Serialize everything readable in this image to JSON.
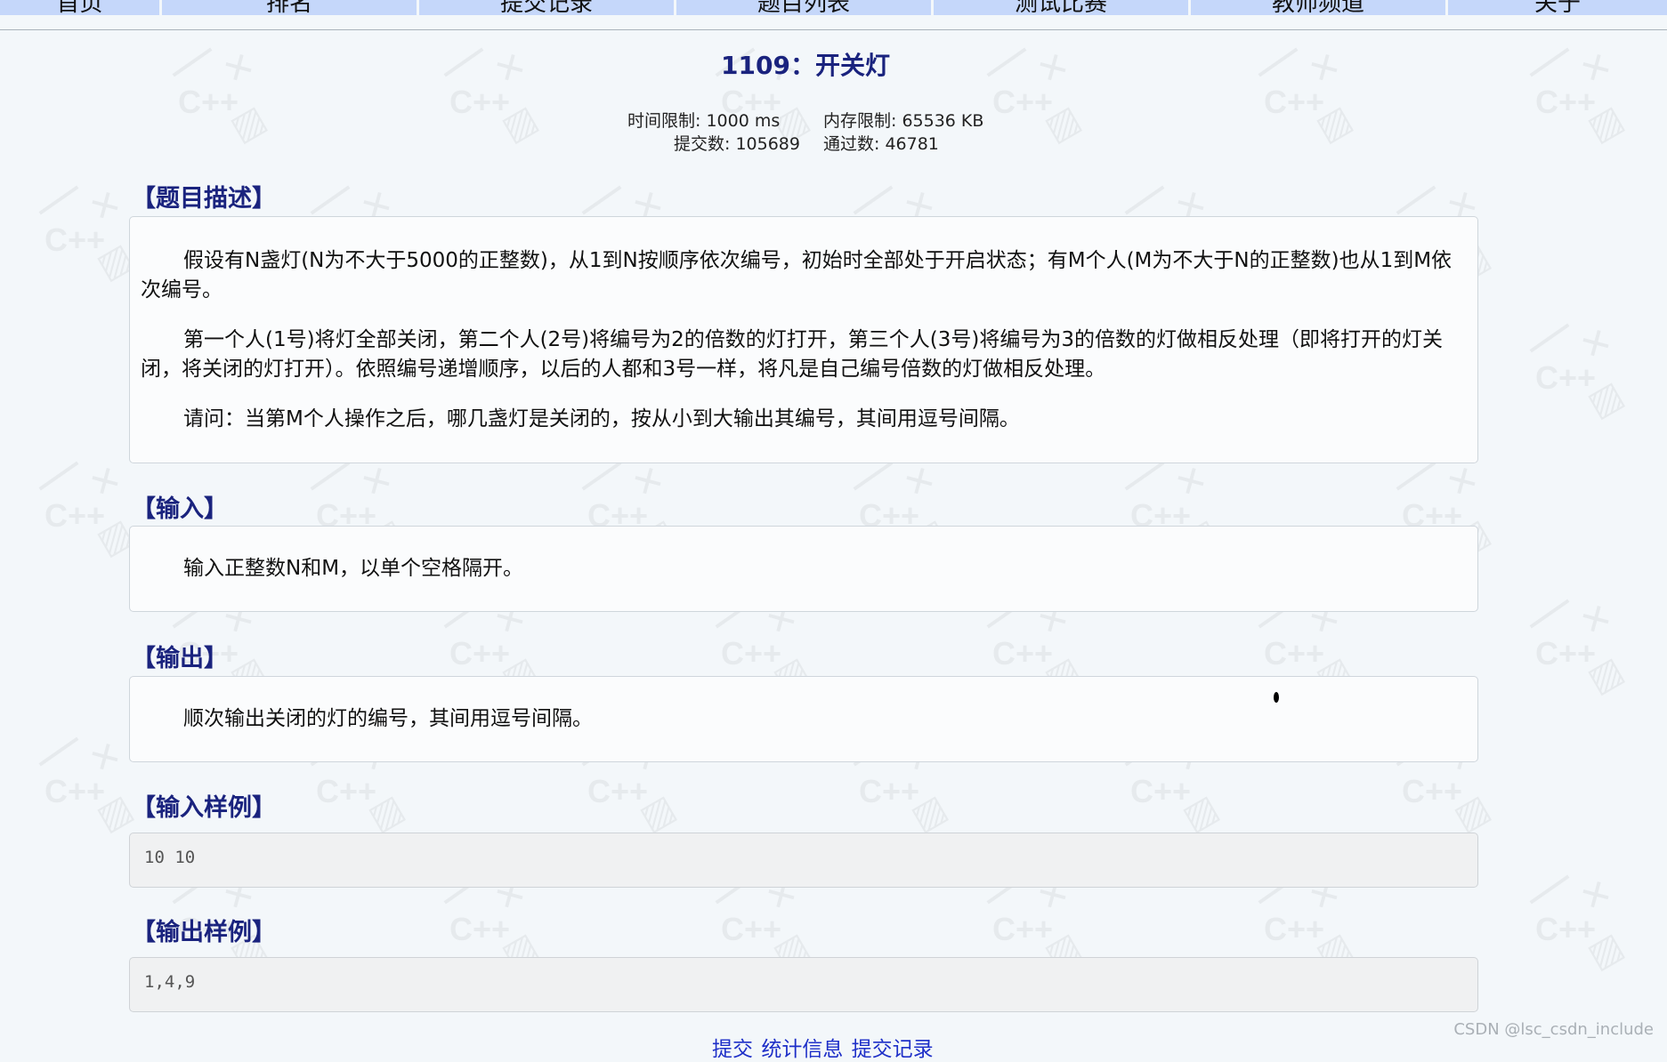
{
  "nav": {
    "items": [
      {
        "label": "首页"
      },
      {
        "label": "排名"
      },
      {
        "label": "提交记录"
      },
      {
        "label": "题目列表"
      },
      {
        "label": "测试比赛"
      },
      {
        "label": "教师频道"
      },
      {
        "label": "关于"
      }
    ]
  },
  "problem": {
    "title": "1109：开关灯",
    "time_limit": "时间限制: 1000 ms",
    "memory_limit": "内存限制: 65536 KB",
    "submissions": "提交数: 105689",
    "accepted": "通过数: 46781"
  },
  "sections": {
    "description": {
      "heading": "【题目描述】",
      "paragraphs": [
        "假设有N盏灯(N为不大于5000的正整数)，从1到N按顺序依次编号，初始时全部处于开启状态；有M个人(M为不大于N的正整数)也从1到M依次编号。",
        "第一个人(1号)将灯全部关闭，第二个人(2号)将编号为2的倍数的灯打开，第三个人(3号)将编号为3的倍数的灯做相反处理（即将打开的灯关闭，将关闭的灯打开）。依照编号递增顺序，以后的人都和3号一样，将凡是自己编号倍数的灯做相反处理。",
        "请问：当第M个人操作之后，哪几盏灯是关闭的，按从小到大输出其编号，其间用逗号间隔。"
      ]
    },
    "input": {
      "heading": "【输入】",
      "text": "输入正整数N和M，以单个空格隔开。"
    },
    "output": {
      "heading": "【输出】",
      "text": "顺次输出关闭的灯的编号，其间用逗号间隔。"
    },
    "sample_input": {
      "heading": "【输入样例】",
      "code": "10 10"
    },
    "sample_output": {
      "heading": "【输出样例】",
      "code": "1,4,9"
    }
  },
  "links": {
    "submit": "提交",
    "stats": "统计信息",
    "records": "提交记录"
  },
  "watermark_text": "C++",
  "footer_credit": "CSDN @lsc_csdn_include",
  "colors": {
    "nav_bg": "#c5d7fa",
    "title": "#1a237e",
    "link": "#1e2fc8"
  }
}
